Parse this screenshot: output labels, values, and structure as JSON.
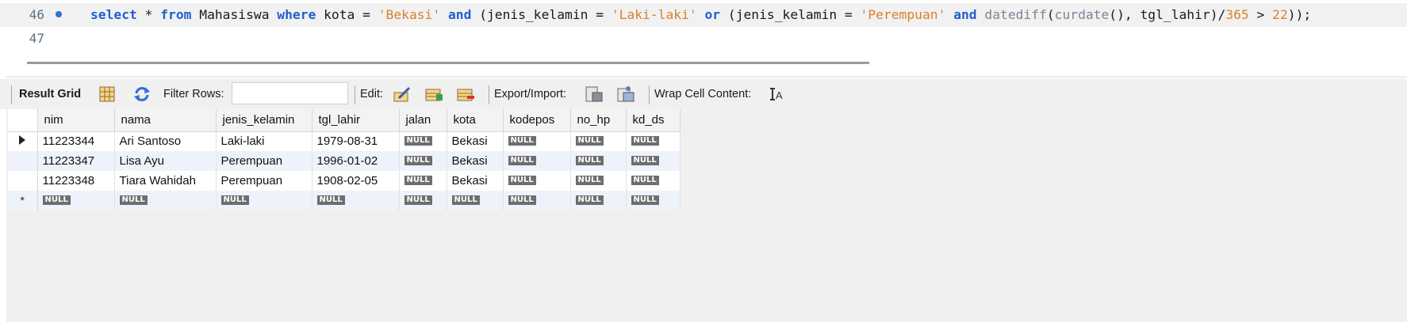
{
  "editor": {
    "lines": [
      {
        "number": "46",
        "has_bullet": true
      },
      {
        "number": "47",
        "has_bullet": false
      }
    ],
    "query_text": "select * from Mahasiswa where kota = 'Bekasi' and (jenis_kelamin = 'Laki-laki' or (jenis_kelamin = 'Perempuan' and datediff(curdate(), tgl_lahir)/365 > 22));",
    "tokens": {
      "select": "select",
      "star": " * ",
      "from": "from",
      "table": " Mahasiswa ",
      "where": "where",
      "cond1": " kota = ",
      "bekasi": "'Bekasi'",
      "and1": "and",
      "paren1": " (jenis_kelamin = ",
      "laki": "'Laki-laki'",
      "or": "or",
      "paren2": " (jenis_kelamin = ",
      "perempuan": "'Perempuan'",
      "and2": "and",
      "datediff": "datediff",
      "open": "(",
      "curdate": "curdate",
      "mid": "(), tgl_lahir)/",
      "n365": "365",
      "gt": " > ",
      "n22": "22",
      "end": "));"
    }
  },
  "toolbar": {
    "result_grid": "Result Grid",
    "filter_rows": "Filter Rows:",
    "filter_value": "",
    "edit": "Edit:",
    "export_import": "Export/Import:",
    "wrap_cell": "Wrap Cell Content:"
  },
  "grid": {
    "columns": [
      "nim",
      "nama",
      "jenis_kelamin",
      "tgl_lahir",
      "jalan",
      "kota",
      "kodepos",
      "no_hp",
      "kd_ds"
    ],
    "rows": [
      [
        "11223344",
        "Ari Santoso",
        "Laki-laki",
        "1979-08-31",
        "NULL",
        "Bekasi",
        "NULL",
        "NULL",
        "NULL"
      ],
      [
        "11223347",
        "Lisa Ayu",
        "Perempuan",
        "1996-01-02",
        "NULL",
        "Bekasi",
        "NULL",
        "NULL",
        "NULL"
      ],
      [
        "11223348",
        "Tiara Wahidah",
        "Perempuan",
        "1908-02-05",
        "NULL",
        "Bekasi",
        "NULL",
        "NULL",
        "NULL"
      ]
    ],
    "new_row": [
      "NULL",
      "NULL",
      "NULL",
      "NULL",
      "NULL",
      "NULL",
      "NULL",
      "NULL",
      "NULL"
    ],
    "new_row_marker": "*"
  }
}
